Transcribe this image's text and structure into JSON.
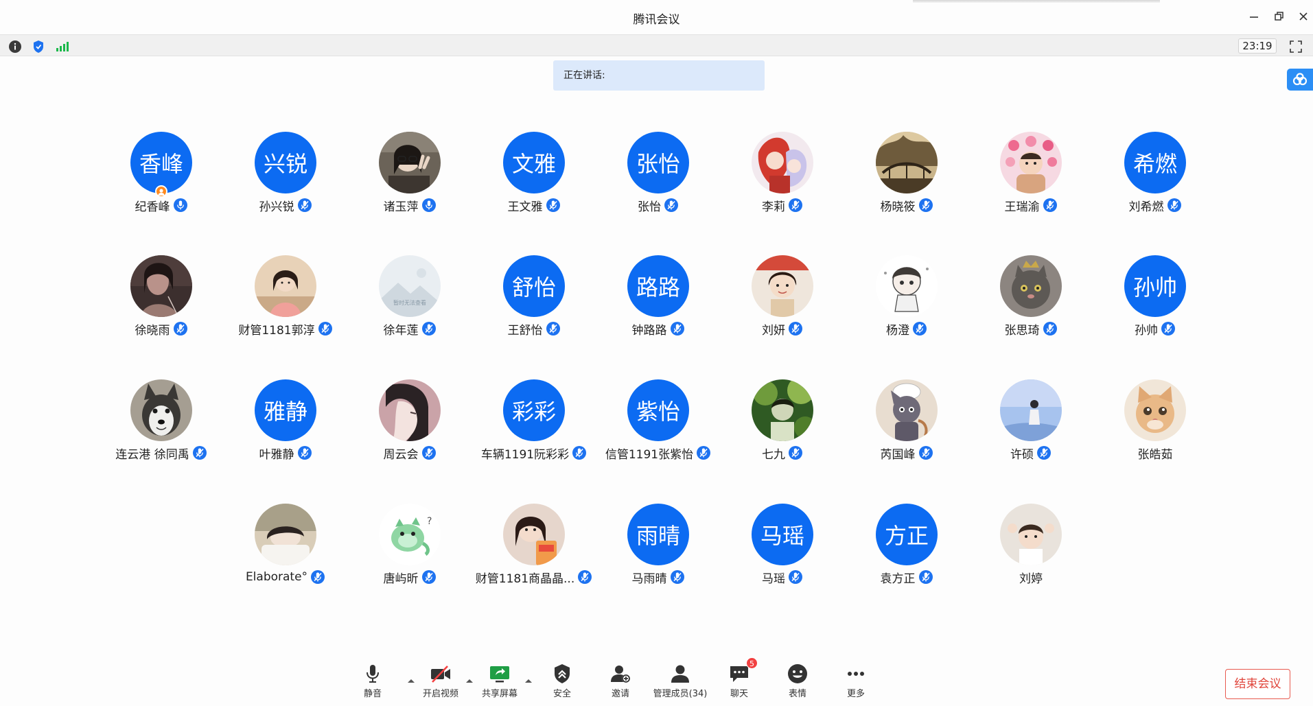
{
  "window": {
    "title": "腾讯会议"
  },
  "infobar": {
    "clock": "23:19"
  },
  "speaking": {
    "label": "正在讲话:"
  },
  "colors": {
    "accent": "#0c6bf2",
    "mic": "#1d72f0",
    "end": "#e0443a",
    "badge": "#f24141",
    "signal": "#19b84a"
  },
  "participants": [
    {
      "name": "纪香峰",
      "avatar_text": "香峰",
      "avatar_kind": "text",
      "host": true,
      "mic": "unmuted"
    },
    {
      "name": "孙兴锐",
      "avatar_text": "兴锐",
      "avatar_kind": "text",
      "mic": "muted"
    },
    {
      "name": "诸玉萍",
      "avatar_kind": "photo",
      "photo": "girl-peace-sign",
      "mic": "unmuted"
    },
    {
      "name": "王文雅",
      "avatar_text": "文雅",
      "avatar_kind": "text",
      "mic": "muted"
    },
    {
      "name": "张怡",
      "avatar_text": "张怡",
      "avatar_kind": "text",
      "mic": "muted"
    },
    {
      "name": "李莉",
      "avatar_kind": "photo",
      "photo": "anime-red-hair",
      "mic": "muted"
    },
    {
      "name": "杨晓筱",
      "avatar_kind": "photo",
      "photo": "bridge-landscape",
      "mic": "muted"
    },
    {
      "name": "王瑞渝",
      "avatar_kind": "photo",
      "photo": "baby-flowers",
      "mic": "muted"
    },
    {
      "name": "刘希燃",
      "avatar_text": "希燃",
      "avatar_kind": "text",
      "mic": "muted"
    },
    {
      "name": "徐晓雨",
      "avatar_kind": "photo",
      "photo": "dark-portrait",
      "mic": "muted"
    },
    {
      "name": "财管1181郭淳",
      "avatar_kind": "photo",
      "photo": "girl-bob-hair",
      "mic": "muted"
    },
    {
      "name": "徐年莲",
      "avatar_kind": "photo",
      "photo": "placeholder-image",
      "placeholder_text": "暂时无法查看",
      "mic": "muted"
    },
    {
      "name": "王舒怡",
      "avatar_text": "舒怡",
      "avatar_kind": "text",
      "mic": "muted"
    },
    {
      "name": "钟路路",
      "avatar_text": "路路",
      "avatar_kind": "text",
      "mic": "muted"
    },
    {
      "name": "刘妍",
      "avatar_kind": "photo",
      "photo": "child-portrait",
      "mic": "muted"
    },
    {
      "name": "杨澄",
      "avatar_kind": "photo",
      "photo": "chibi-sketch",
      "mic": "muted"
    },
    {
      "name": "张思琦",
      "avatar_kind": "photo",
      "photo": "grey-cat-crown",
      "mic": "muted"
    },
    {
      "name": "孙帅",
      "avatar_text": "孙帅",
      "avatar_kind": "text",
      "mic": "muted"
    },
    {
      "name": "连云港 徐同禹",
      "avatar_kind": "photo",
      "photo": "husky-dog",
      "mic": "muted"
    },
    {
      "name": "叶雅静",
      "avatar_text": "雅静",
      "avatar_kind": "text",
      "mic": "muted"
    },
    {
      "name": "周云会",
      "avatar_kind": "photo",
      "photo": "anime-profile",
      "mic": "muted"
    },
    {
      "name": "车辆1191阮彩彩",
      "avatar_text": "彩彩",
      "avatar_kind": "text",
      "mic": "muted"
    },
    {
      "name": "信管1191张紫怡",
      "avatar_text": "紫怡",
      "avatar_kind": "text",
      "mic": "muted"
    },
    {
      "name": "七九",
      "avatar_kind": "photo",
      "photo": "green-foliage-portrait",
      "mic": "muted"
    },
    {
      "name": "芮国峰",
      "avatar_kind": "photo",
      "photo": "cartoon-cat-chef",
      "mic": "muted"
    },
    {
      "name": "许硕",
      "avatar_kind": "photo",
      "photo": "sky-figure",
      "mic": "muted"
    },
    {
      "name": "张皓茹",
      "avatar_kind": "photo",
      "photo": "orange-kitten",
      "mic": "none"
    },
    {
      "name": "Elaborate°",
      "avatar_kind": "photo",
      "photo": "girl-lying",
      "mic": "muted"
    },
    {
      "name": "唐屿昕",
      "avatar_kind": "photo",
      "photo": "green-dino-sticker",
      "mic": "muted"
    },
    {
      "name": "财管1181商晶晶...",
      "avatar_kind": "photo",
      "photo": "girl-snack",
      "mic": "muted"
    },
    {
      "name": "马雨晴",
      "avatar_text": "雨晴",
      "avatar_kind": "text",
      "mic": "muted"
    },
    {
      "name": "马瑶",
      "avatar_text": "马瑶",
      "avatar_kind": "text",
      "mic": "muted"
    },
    {
      "name": "袁方正",
      "avatar_text": "方正",
      "avatar_kind": "text",
      "mic": "muted"
    },
    {
      "name": "刘婷",
      "avatar_kind": "photo",
      "photo": "baby-hands",
      "mic": "none"
    }
  ],
  "toolbar": {
    "mute": "静音",
    "video": "开启视频",
    "share": "共享屏幕",
    "security": "安全",
    "invite": "邀请",
    "members": "管理成员(34)",
    "chat": "聊天",
    "chat_badge": "5",
    "reactions": "表情",
    "more": "更多",
    "end": "结束会议"
  }
}
